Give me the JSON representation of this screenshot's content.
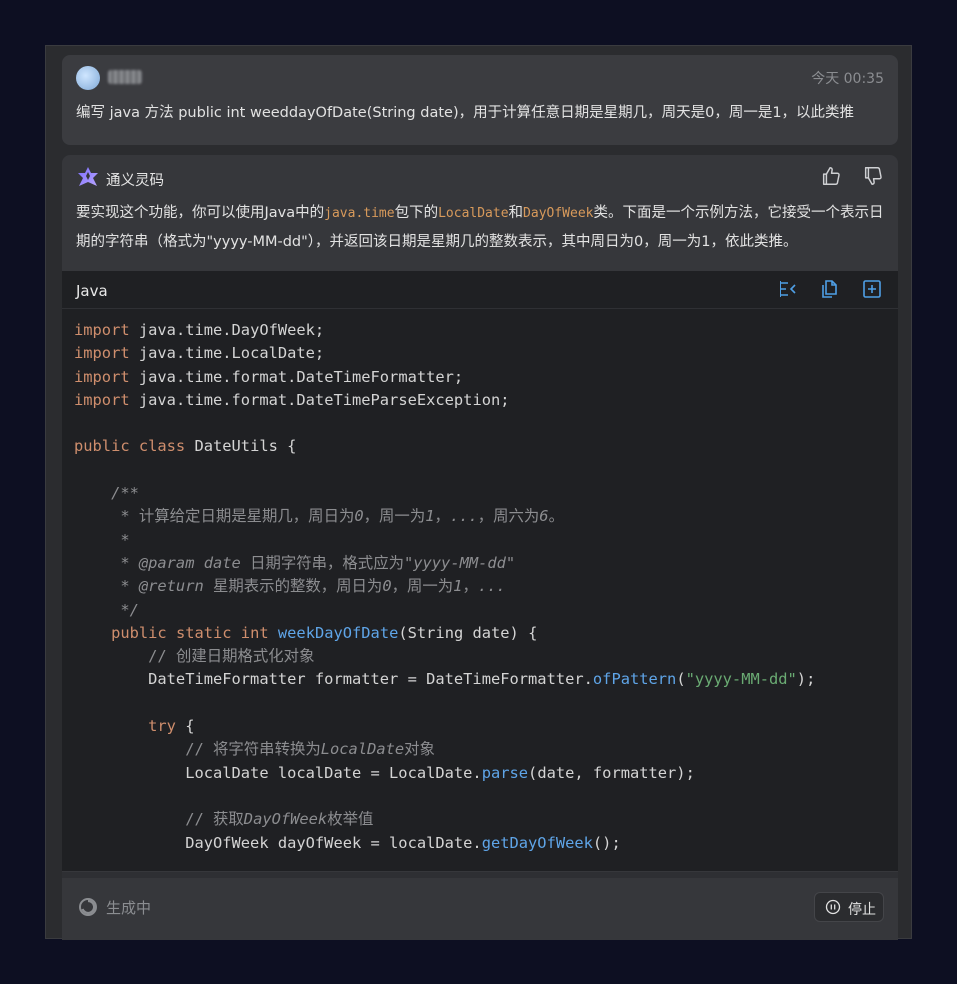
{
  "user_message": {
    "time": "今天 00:35",
    "text": "编写 java 方法 public int weeddayOfDate(String date)，用于计算任意日期是星期几，周天是0，周一是1，以此类推"
  },
  "assistant": {
    "name": "通义灵码",
    "intro_parts": [
      "要实现这个功能，你可以使用Java中的",
      "java.time",
      "包下的",
      "LocalDate",
      "和",
      "DayOfWeek",
      "类。下面是一个示例方法，它接受一个表示日期的字符串（格式为\"yyyy-MM-dd\"），并返回该日期是星期几的整数表示，其中周日为0，周一为1，依此类推。"
    ],
    "code_block": {
      "language": "Java"
    }
  },
  "footer": {
    "status": "生成中",
    "stop_label": "停止"
  },
  "icons": [
    "thumbs-up-icon",
    "thumbs-down-icon",
    "insert-icon",
    "copy-icon",
    "new-file-icon",
    "spinner-icon",
    "stop-icon"
  ]
}
